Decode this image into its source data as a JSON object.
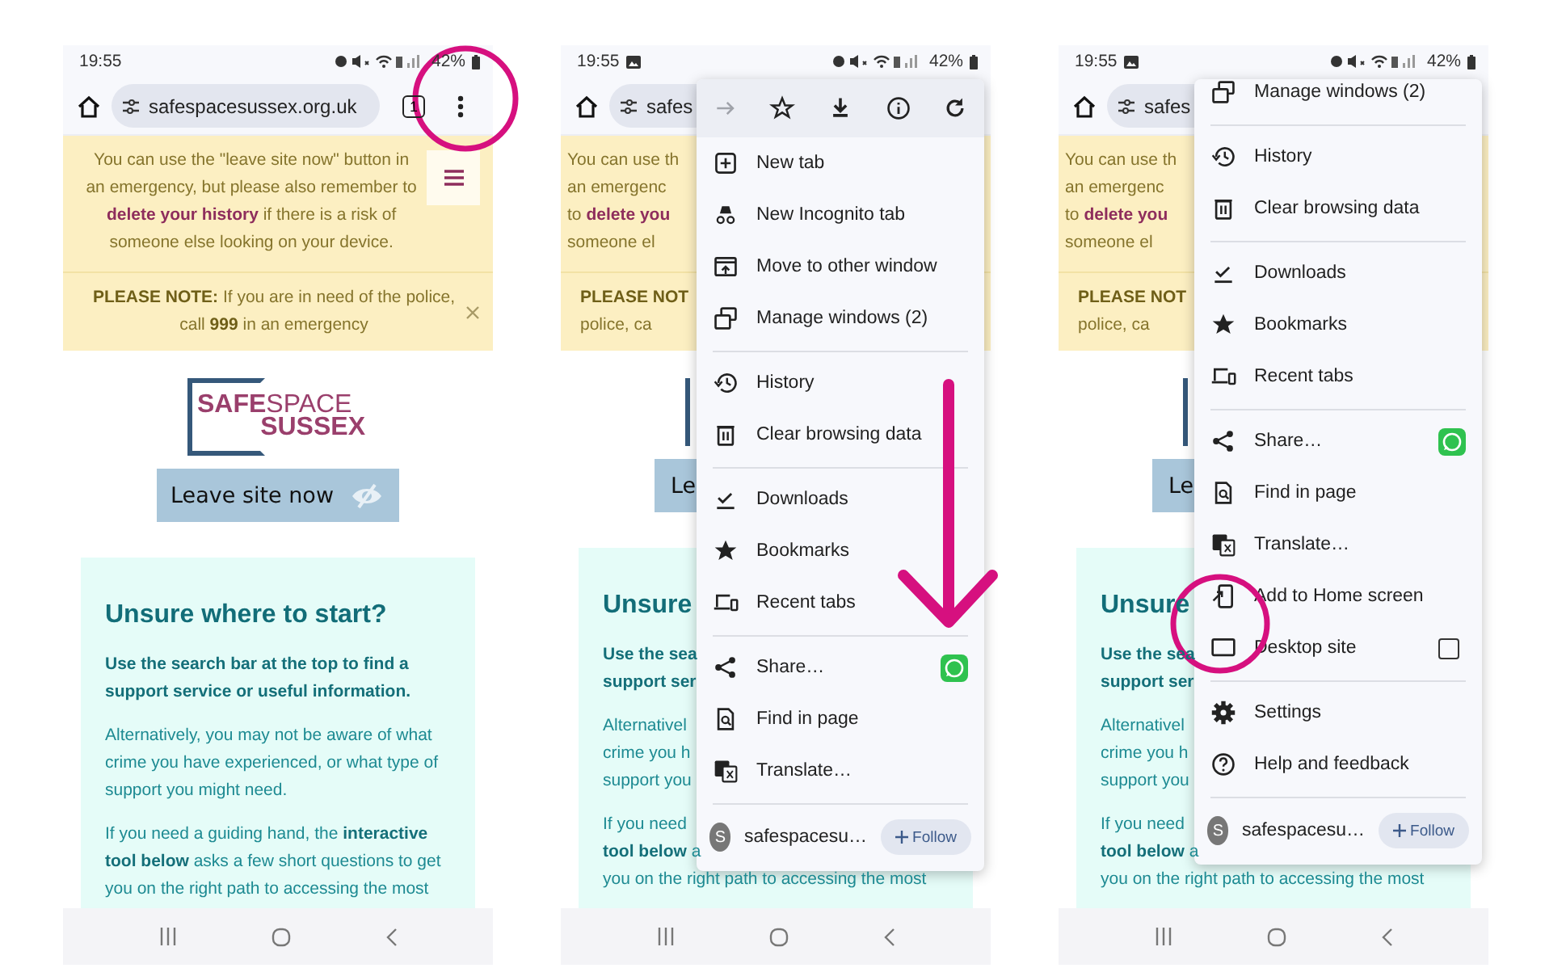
{
  "screens": [
    {
      "status": {
        "time": "19:55",
        "gallery_notification": false,
        "battery": "42%"
      },
      "toolbar": {
        "url": "safespacesussex.org.uk",
        "tab_count": "1",
        "more_button": true
      },
      "page": {
        "kind": "full",
        "banner": "You can use the \"leave site now\" button in an emergency, but please also remember to **delete your history** if there is a risk of someone else looking on your device.",
        "note": "**PLEASE NOTE:** If you are in need of the police, call **999** in an emergency",
        "logo": {
          "word_1": "SAFE",
          "word_2": "SPACE",
          "word_3": "SUSSEX"
        },
        "leave_button": "Leave site now",
        "card": {
          "heading": "Unsure where to start?",
          "paragraphs": [
            {
              "bold": true,
              "text": "Use the search bar at the top to find a support service or useful information."
            },
            {
              "bold": false,
              "text": "Alternatively, you may not be aware of what crime you have experienced, or what type of support you might need."
            },
            {
              "bold": false,
              "text": "If you need a guiding hand, the **interactive tool below** asks a few short questions to get you on the right path to accessing the most"
            }
          ]
        }
      }
    },
    {
      "status": {
        "time": "19:55",
        "gallery_notification": true,
        "battery": "42%"
      },
      "toolbar": {
        "url": "safes",
        "more_button": false
      },
      "page": {
        "kind": "clipped",
        "banner": [
          "You can use th",
          "an emergenc",
          "to **delete you**",
          "someone el"
        ],
        "note": [
          "**PLEASE NOT**",
          "police, ca"
        ],
        "leave_button": "Le",
        "card": {
          "heading": "Unsure",
          "paragraphs": [
            {
              "bold": true,
              "lines": [
                "Use the sea",
                "support ser"
              ]
            },
            {
              "bold": false,
              "lines": [
                "Alternativel",
                "crime you h",
                "support you"
              ]
            },
            {
              "bold": false,
              "lines": [
                "If you need",
                "**tool below** a",
                "you on the right path to accessing the most"
              ]
            }
          ]
        }
      },
      "menu": {
        "scrolled": false,
        "top_row": [
          {
            "kind": "forward",
            "disabled": true
          },
          {
            "kind": "star-outline",
            "disabled": false
          },
          {
            "kind": "download",
            "disabled": false
          },
          {
            "kind": "info",
            "disabled": false
          },
          {
            "kind": "refresh",
            "disabled": false
          }
        ],
        "items": [
          {
            "kind": "plus-box",
            "label": "New tab"
          },
          {
            "kind": "incognito",
            "label": "New Incognito tab"
          },
          {
            "kind": "window-arrow",
            "label": "Move to other window"
          },
          {
            "kind": "windows",
            "label": "Manage windows (2)"
          },
          {
            "kind": "divider"
          },
          {
            "kind": "history",
            "label": "History"
          },
          {
            "kind": "trash",
            "label": "Clear browsing data"
          },
          {
            "kind": "divider"
          },
          {
            "kind": "tick",
            "label": "Downloads"
          },
          {
            "kind": "star",
            "label": "Bookmarks"
          },
          {
            "kind": "devices",
            "label": "Recent tabs"
          },
          {
            "kind": "divider"
          },
          {
            "kind": "share",
            "label": "Share…"
          },
          {
            "kind": "document-search",
            "label": "Find in page"
          },
          {
            "kind": "translate",
            "label": "Translate…"
          },
          {
            "kind": "divider"
          },
          {
            "kind": "site",
            "avatar": "S",
            "label": "safespacesu…",
            "button": "Follow"
          }
        ]
      }
    },
    {
      "status": {
        "time": "19:55",
        "gallery_notification": true,
        "battery": "42%"
      },
      "toolbar": {
        "url": "safes",
        "more_button": false
      },
      "page": {
        "kind": "clipped",
        "banner": [
          "You can use th",
          "an emergenc",
          "to **delete you**",
          "someone el"
        ],
        "note": [
          "**PLEASE NOT**",
          "police, ca"
        ],
        "leave_button": "Le",
        "card": {
          "heading": "Unsure",
          "paragraphs": [
            {
              "bold": true,
              "lines": [
                "Use the sea",
                "support ser"
              ]
            },
            {
              "bold": false,
              "lines": [
                "Alternativel",
                "crime you h",
                "support you"
              ]
            },
            {
              "bold": false,
              "lines": [
                "If you need",
                "**tool below** a",
                "you on the right path to accessing the most"
              ]
            }
          ]
        }
      },
      "menu": {
        "scrolled": true,
        "items": [
          {
            "kind": "windows",
            "label": "Manage windows (2)"
          },
          {
            "kind": "divider"
          },
          {
            "kind": "history",
            "label": "History"
          },
          {
            "kind": "trash",
            "label": "Clear browsing data"
          },
          {
            "kind": "divider"
          },
          {
            "kind": "tick",
            "label": "Downloads"
          },
          {
            "kind": "star",
            "label": "Bookmarks"
          },
          {
            "kind": "devices",
            "label": "Recent tabs"
          },
          {
            "kind": "divider"
          },
          {
            "kind": "share",
            "label": "Share…"
          },
          {
            "kind": "document-search",
            "label": "Find in page"
          },
          {
            "kind": "translate",
            "label": "Translate…"
          },
          {
            "kind": "phone-arrow",
            "label": "Add to Home screen"
          },
          {
            "kind": "desktop",
            "label": "Desktop site",
            "checked": false
          },
          {
            "kind": "divider"
          },
          {
            "kind": "settings",
            "label": "Settings"
          },
          {
            "kind": "help",
            "label": "Help and feedback"
          },
          {
            "kind": "divider"
          },
          {
            "kind": "site",
            "avatar": "S",
            "label": "safespacesu…",
            "button": "Follow"
          }
        ]
      }
    }
  ]
}
